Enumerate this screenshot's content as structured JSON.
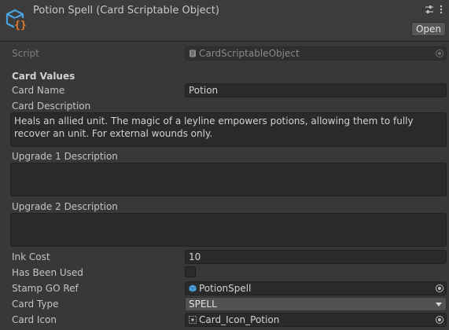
{
  "header": {
    "title": "Potion Spell (Card Scriptable Object)",
    "open_label": "Open"
  },
  "script": {
    "label": "Script",
    "value": "CardScriptableObject"
  },
  "section": {
    "title": "Card Values"
  },
  "fields": {
    "card_name": {
      "label": "Card Name",
      "value": "Potion"
    },
    "card_description": {
      "label": "Card Description",
      "value": "Heals an allied unit. The magic of a leyline empowers potions, allowing them to fully recover an unit. For external wounds only."
    },
    "upgrade1": {
      "label": "Upgrade 1 Description",
      "value": ""
    },
    "upgrade2": {
      "label": "Upgrade 2 Description",
      "value": ""
    },
    "ink_cost": {
      "label": "Ink Cost",
      "value": "10"
    },
    "has_been_used": {
      "label": "Has Been Used",
      "value": false
    },
    "stamp_go_ref": {
      "label": "Stamp GO Ref",
      "value": "PotionSpell"
    },
    "card_type": {
      "label": "Card Type",
      "value": "SPELL"
    },
    "card_icon": {
      "label": "Card Icon",
      "value": "Card_Icon_Potion"
    }
  },
  "icons": {
    "header": "scriptable-object-icon",
    "script": "cs-script-icon",
    "stamp": "prefab-cube-icon",
    "card_icon": "sprite-icon"
  },
  "colors": {
    "icon_blue": "#4aa3df",
    "icon_orange": "#e8772e",
    "background": "#383838",
    "field_bg": "#2a2a2a"
  }
}
